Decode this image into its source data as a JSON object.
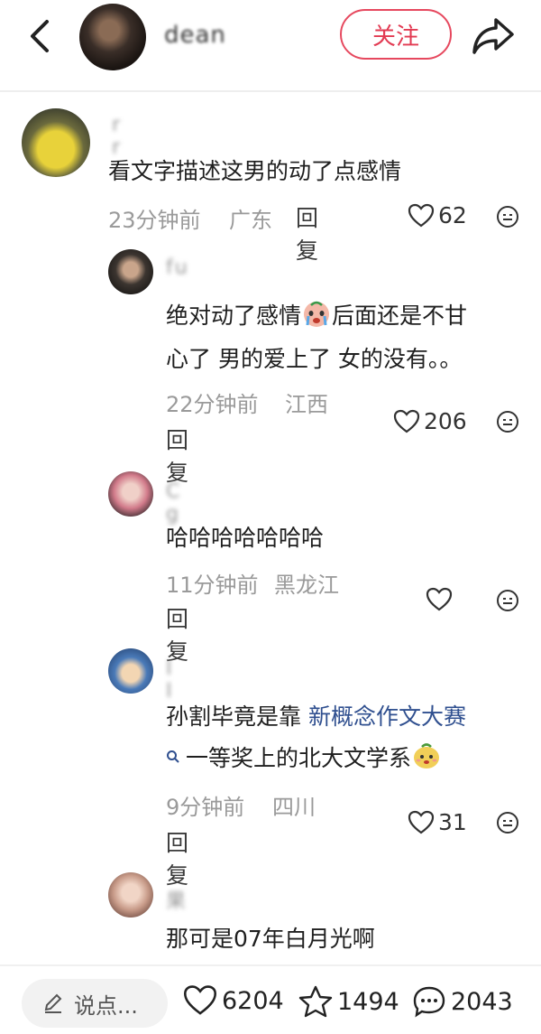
{
  "header": {
    "username": "dean",
    "follow_label": "关注"
  },
  "comments": [
    {
      "username": "r  r",
      "text_lines": [
        "看文字描述这男的动了点感情"
      ],
      "time": "23分钟前",
      "location": "广东",
      "reply_label": "回复",
      "likes": "62"
    },
    {
      "username": "fu",
      "text_lines": [
        "绝对动了感情",
        "后面还是不甘",
        "心了 男的爱上了 女的没有。。"
      ],
      "time": "22分钟前",
      "location": "江西",
      "reply_label": "回复",
      "likes": "206"
    },
    {
      "username": "C       g",
      "text_lines": [
        "哈哈哈哈哈哈哈"
      ],
      "time": "11分钟前",
      "location": "黑龙江",
      "reply_label": "回复",
      "likes": ""
    },
    {
      "username": "I  I",
      "text_lines": [
        "孙割毕竟是靠 ",
        "新概念作文大赛",
        "一等奖上的北大文学系"
      ],
      "time": "9分钟前",
      "location": "四川",
      "reply_label": "回复",
      "likes": "31"
    },
    {
      "username": "果",
      "text_lines": [
        "那可是07年白月光啊"
      ]
    }
  ],
  "bottom_bar": {
    "input_placeholder": "说点...",
    "likes": "6204",
    "favorites": "1494",
    "comments": "2043"
  }
}
